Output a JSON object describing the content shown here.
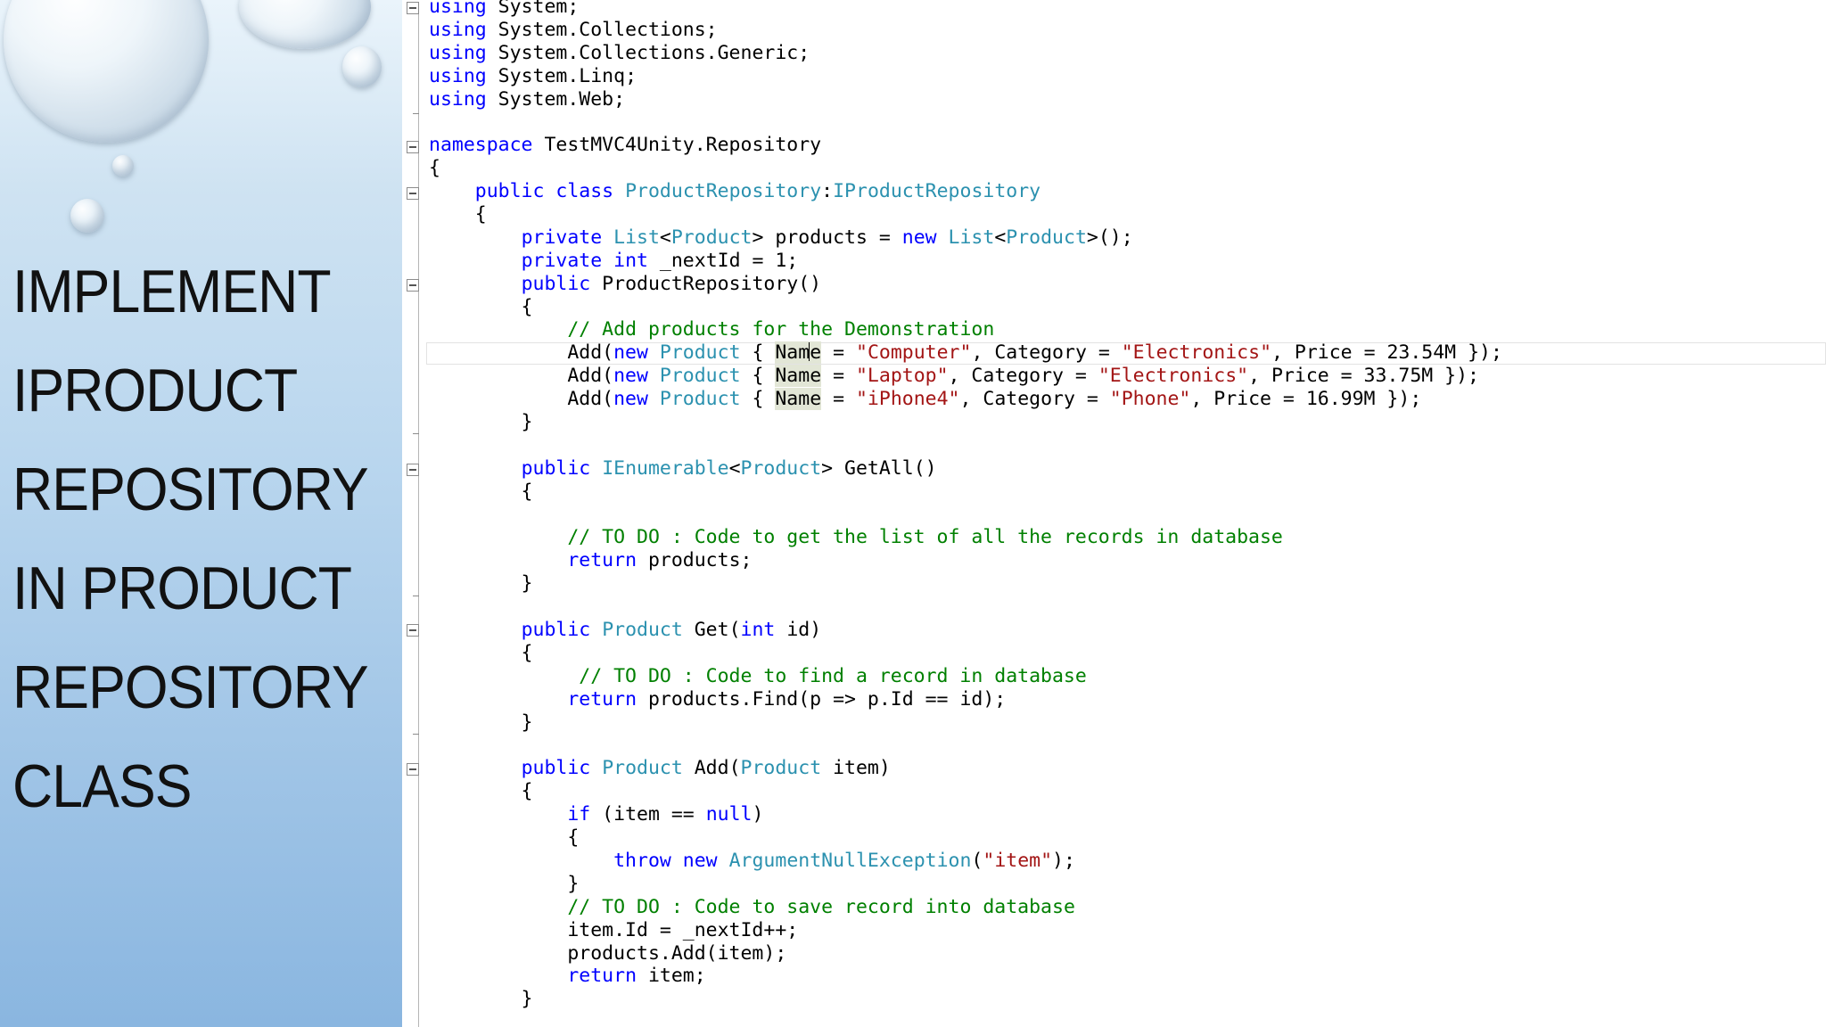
{
  "slide": {
    "title_lines": [
      "IMPLEMENT",
      "IPRODUCT",
      "REPOSITORY",
      "IN PRODUCT",
      "REPOSITORY",
      "CLASS"
    ]
  },
  "editor": {
    "lines": [
      [
        {
          "t": "using",
          "c": "kw"
        },
        {
          "t": " System;"
        }
      ],
      [
        {
          "t": "using",
          "c": "kw"
        },
        {
          "t": " System.Collections;"
        }
      ],
      [
        {
          "t": "using",
          "c": "kw"
        },
        {
          "t": " System.Collections.Generic;"
        }
      ],
      [
        {
          "t": "using",
          "c": "kw"
        },
        {
          "t": " System.Linq;"
        }
      ],
      [
        {
          "t": "using",
          "c": "kw"
        },
        {
          "t": " System.Web;"
        }
      ],
      [],
      [
        {
          "t": "namespace",
          "c": "kw"
        },
        {
          "t": " TestMVC4Unity.Repository"
        }
      ],
      [
        {
          "t": "{"
        }
      ],
      [
        {
          "t": "    "
        },
        {
          "t": "public",
          "c": "kw"
        },
        {
          "t": " "
        },
        {
          "t": "class",
          "c": "kw"
        },
        {
          "t": " "
        },
        {
          "t": "ProductRepository",
          "c": "ty"
        },
        {
          "t": ":"
        },
        {
          "t": "IProductRepository",
          "c": "ty"
        }
      ],
      [
        {
          "t": "    {"
        }
      ],
      [
        {
          "t": "        "
        },
        {
          "t": "private",
          "c": "kw"
        },
        {
          "t": " "
        },
        {
          "t": "List",
          "c": "ty"
        },
        {
          "t": "<"
        },
        {
          "t": "Product",
          "c": "ty"
        },
        {
          "t": "> products = "
        },
        {
          "t": "new",
          "c": "kw"
        },
        {
          "t": " "
        },
        {
          "t": "List",
          "c": "ty"
        },
        {
          "t": "<"
        },
        {
          "t": "Product",
          "c": "ty"
        },
        {
          "t": ">();"
        }
      ],
      [
        {
          "t": "        "
        },
        {
          "t": "private",
          "c": "kw"
        },
        {
          "t": " "
        },
        {
          "t": "int",
          "c": "kw"
        },
        {
          "t": " _nextId = 1;"
        }
      ],
      [
        {
          "t": "        "
        },
        {
          "t": "public",
          "c": "kw"
        },
        {
          "t": " ProductRepository()"
        }
      ],
      [
        {
          "t": "        {"
        }
      ],
      [
        {
          "t": "            "
        },
        {
          "t": "// Add products for the Demonstration",
          "c": "cm"
        }
      ],
      [
        {
          "t": "            Add("
        },
        {
          "t": "new",
          "c": "kw"
        },
        {
          "t": " "
        },
        {
          "t": "Product",
          "c": "ty"
        },
        {
          "t": " { "
        },
        {
          "t": "Nam",
          "c": "hl"
        },
        {
          "t": "",
          "c": "caret"
        },
        {
          "t": "e",
          "c": "hl"
        },
        {
          "t": " = "
        },
        {
          "t": "\"Computer\"",
          "c": "str"
        },
        {
          "t": ", Category = "
        },
        {
          "t": "\"Electronics\"",
          "c": "str"
        },
        {
          "t": ", Price = 23.54M });"
        }
      ],
      [
        {
          "t": "            Add("
        },
        {
          "t": "new",
          "c": "kw"
        },
        {
          "t": " "
        },
        {
          "t": "Product",
          "c": "ty"
        },
        {
          "t": " { "
        },
        {
          "t": "Name",
          "c": "hl"
        },
        {
          "t": " = "
        },
        {
          "t": "\"Laptop\"",
          "c": "str"
        },
        {
          "t": ", Category = "
        },
        {
          "t": "\"Electronics\"",
          "c": "str"
        },
        {
          "t": ", Price = 33.75M });"
        }
      ],
      [
        {
          "t": "            Add("
        },
        {
          "t": "new",
          "c": "kw"
        },
        {
          "t": " "
        },
        {
          "t": "Product",
          "c": "ty"
        },
        {
          "t": " { "
        },
        {
          "t": "Name",
          "c": "hl"
        },
        {
          "t": " = "
        },
        {
          "t": "\"iPhone4\"",
          "c": "str"
        },
        {
          "t": ", Category = "
        },
        {
          "t": "\"Phone\"",
          "c": "str"
        },
        {
          "t": ", Price = 16.99M });"
        }
      ],
      [
        {
          "t": "        }"
        }
      ],
      [],
      [
        {
          "t": "        "
        },
        {
          "t": "public",
          "c": "kw"
        },
        {
          "t": " "
        },
        {
          "t": "IEnumerable",
          "c": "ty"
        },
        {
          "t": "<"
        },
        {
          "t": "Product",
          "c": "ty"
        },
        {
          "t": "> GetAll()"
        }
      ],
      [
        {
          "t": "        {"
        }
      ],
      [],
      [
        {
          "t": "            "
        },
        {
          "t": "// TO DO : Code to get the list of all the records in database",
          "c": "cm"
        }
      ],
      [
        {
          "t": "            "
        },
        {
          "t": "return",
          "c": "kw"
        },
        {
          "t": " products;"
        }
      ],
      [
        {
          "t": "        }"
        }
      ],
      [],
      [
        {
          "t": "        "
        },
        {
          "t": "public",
          "c": "kw"
        },
        {
          "t": " "
        },
        {
          "t": "Product",
          "c": "ty"
        },
        {
          "t": " Get("
        },
        {
          "t": "int",
          "c": "kw"
        },
        {
          "t": " id)"
        }
      ],
      [
        {
          "t": "        {"
        }
      ],
      [
        {
          "t": "             "
        },
        {
          "t": "// TO DO : Code to find a record in database",
          "c": "cm"
        }
      ],
      [
        {
          "t": "            "
        },
        {
          "t": "return",
          "c": "kw"
        },
        {
          "t": " products.Find(p => p.Id == id);"
        }
      ],
      [
        {
          "t": "        }"
        }
      ],
      [],
      [
        {
          "t": "        "
        },
        {
          "t": "public",
          "c": "kw"
        },
        {
          "t": " "
        },
        {
          "t": "Product",
          "c": "ty"
        },
        {
          "t": " Add("
        },
        {
          "t": "Product",
          "c": "ty"
        },
        {
          "t": " item)"
        }
      ],
      [
        {
          "t": "        {"
        }
      ],
      [
        {
          "t": "            "
        },
        {
          "t": "if",
          "c": "kw"
        },
        {
          "t": " (item == "
        },
        {
          "t": "null",
          "c": "kw"
        },
        {
          "t": ")"
        }
      ],
      [
        {
          "t": "            {"
        }
      ],
      [
        {
          "t": "                "
        },
        {
          "t": "throw",
          "c": "kw"
        },
        {
          "t": " "
        },
        {
          "t": "new",
          "c": "kw"
        },
        {
          "t": " "
        },
        {
          "t": "ArgumentNullException",
          "c": "ty"
        },
        {
          "t": "("
        },
        {
          "t": "\"item\"",
          "c": "str"
        },
        {
          "t": ");"
        }
      ],
      [
        {
          "t": "            }"
        }
      ],
      [
        {
          "t": "            "
        },
        {
          "t": "// TO DO : Code to save record into database",
          "c": "cm"
        }
      ],
      [
        {
          "t": "            item.Id = _nextId++;"
        }
      ],
      [
        {
          "t": "            products.Add(item);"
        }
      ],
      [
        {
          "t": "            "
        },
        {
          "t": "return",
          "c": "kw"
        },
        {
          "t": " item;"
        }
      ],
      [
        {
          "t": "        }"
        }
      ]
    ]
  }
}
